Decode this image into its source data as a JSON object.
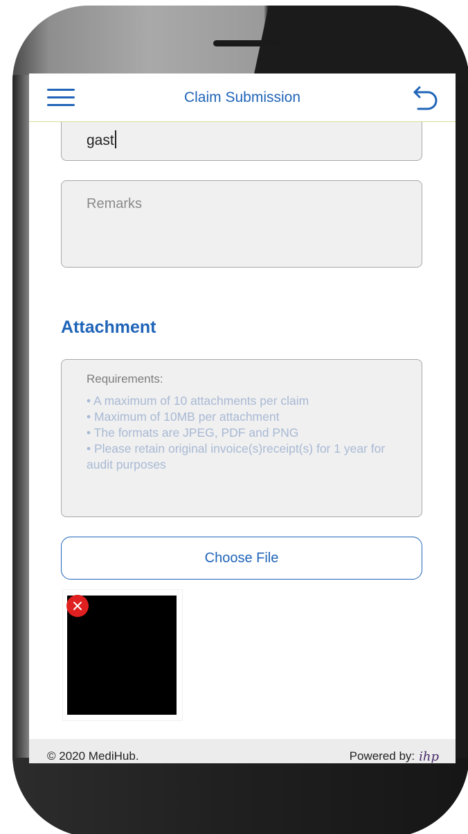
{
  "header": {
    "title": "Claim Submission"
  },
  "form": {
    "current_value": "gast",
    "remarks_placeholder": "Remarks"
  },
  "attachment": {
    "section_title": "Attachment",
    "requirements_title": "Requirements:",
    "requirements": [
      "• A maximum of 10 attachments per claim",
      "• Maximum of 10MB per attachment",
      "• The formats are JPEG, PDF and PNG",
      "• Please retain original invoice(s)receipt(s) for 1 year for audit purposes"
    ],
    "choose_file_label": "Choose File",
    "remove_icon": "×"
  },
  "footer": {
    "copyright": "© 2020 MediHub.",
    "powered_label": "Powered by:",
    "logo_text": "ihp"
  },
  "colors": {
    "accent": "#1f64b8",
    "remove": "#e02020",
    "field_bg": "#f0f0f0"
  }
}
